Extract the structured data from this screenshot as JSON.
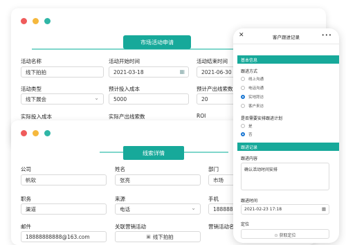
{
  "back_form": {
    "ribbon": "市场活动申请",
    "fields": [
      {
        "label": "活动名称",
        "value": "线下拍拍"
      },
      {
        "label": "活动开始时间",
        "value": "2021-03-18"
      },
      {
        "label": "活动结束时间",
        "value": "2021-06-30"
      },
      {
        "label": "活动类型",
        "value": "线下展会"
      },
      {
        "label": "预计投入成本",
        "value": "5000"
      },
      {
        "label": "预计产出线索数",
        "value": "20"
      },
      {
        "label": "实际投入成本"
      },
      {
        "label": "实际产出线索数"
      },
      {
        "label": "ROI"
      }
    ]
  },
  "front_form": {
    "ribbon": "线索详情",
    "fields": [
      {
        "label": "公司",
        "value": "帆软"
      },
      {
        "label": "姓名",
        "value": "张亮"
      },
      {
        "label": "部门",
        "value": "市场"
      },
      {
        "label": "职务",
        "value": "渠道"
      },
      {
        "label": "来源",
        "value": "电话"
      },
      {
        "label": "手机",
        "value": "18888888"
      },
      {
        "label": "邮件",
        "value": "18888888888@163.com"
      },
      {
        "label": "关联营销活动",
        "value": "线下拍拍"
      },
      {
        "label": "营销活动名"
      }
    ]
  },
  "phone": {
    "title": "客户跟进记录",
    "section_basic": "基本信息",
    "follow_method_label": "跟进方式",
    "follow_methods": [
      "线上沟通",
      "电话沟通",
      "实地拜访",
      "客户来访"
    ],
    "follow_method_selected": 2,
    "next_plan_label": "是否需要安排跟进计划",
    "next_plan_options": [
      "是",
      "否"
    ],
    "next_plan_selected": 1,
    "section_record": "跟进记录",
    "content_label": "跟进内容",
    "content_value": "确认活动时间安排",
    "time_label": "跟进时间",
    "time_value": "2021-02-23 17:18",
    "location_label": "定位",
    "location_button": "获取定位"
  }
}
